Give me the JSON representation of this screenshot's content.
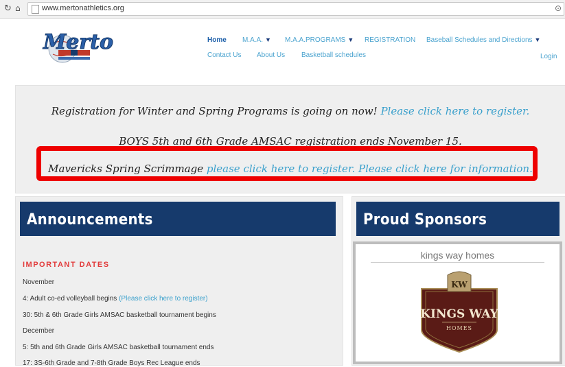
{
  "browser": {
    "url": "www.mertonathletics.org"
  },
  "logo": {
    "text": "Merton"
  },
  "nav": {
    "home": "Home",
    "maa": "M.A.A.",
    "maa_programs": "M.A.A.PROGRAMS",
    "registration": "REGISTRATION",
    "baseball": "Baseball Schedules and Directions",
    "contact": "Contact Us",
    "about": "About Us",
    "basketball": "Basketball schedules",
    "login": "Login"
  },
  "hero": {
    "line1_text": "Registration for Winter and Spring Programs is going on now!",
    "line1_link": "Please click here to register.",
    "line2_text": "BOYS 5th and 6th Grade AMSAC registration ends November 15.",
    "line3_text": "Mavericks Spring Scrimmage",
    "line3_link1": "please click here to register.",
    "line3_link2": "Please click here for information."
  },
  "announcements": {
    "title": "Announcements",
    "important_dates": "IMPORTANT DATES",
    "month1": "November",
    "item1_text": "4: Adult co-ed volleyball begins",
    "item1_link": "(Please click here to register)",
    "item2_text": "30: 5th & 6th Grade Girls AMSAC basketball tournament begins",
    "month2": "December",
    "item3_text": "5: 5th and 6th Grade Girls AMSAC basketball tournament ends",
    "item4_text": "17: 3S-6th Grade and 7-8th Grade Boys Rec League ends"
  },
  "sponsors": {
    "title": "Proud Sponsors",
    "sponsor_name": "kings way homes",
    "logo_line1": "KINGS WAY",
    "logo_line2": "HOMES",
    "logo_mark": "KW"
  },
  "colors": {
    "banner": "#163a6c",
    "link": "#3aa0cc",
    "highlight": "#ee0000",
    "important": "#e23b3b"
  }
}
